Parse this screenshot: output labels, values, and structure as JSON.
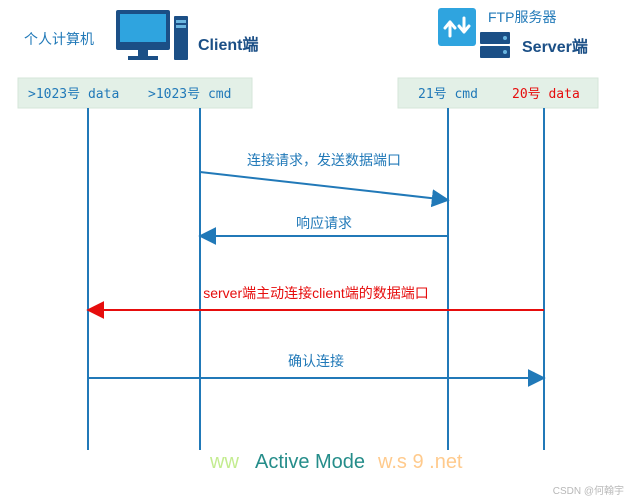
{
  "left": {
    "cn": "个人计算机",
    "en": "Client端",
    "port_data": ">1023号 data",
    "port_cmd": ">1023号 cmd"
  },
  "right": {
    "cn": "FTP服务器",
    "en": "Server端",
    "port_cmd": "21号 cmd",
    "port_data": "20号 data"
  },
  "msgs": {
    "m1": "连接请求，发送数据端口",
    "m2": "响应请求",
    "m3": "server端主动连接client端的数据端口",
    "m4": "确认连接"
  },
  "title": "Active Mode",
  "watermark_left": "ww",
  "watermark_right": "w.s 9 .net",
  "attrib": "CSDN @何翰宇"
}
